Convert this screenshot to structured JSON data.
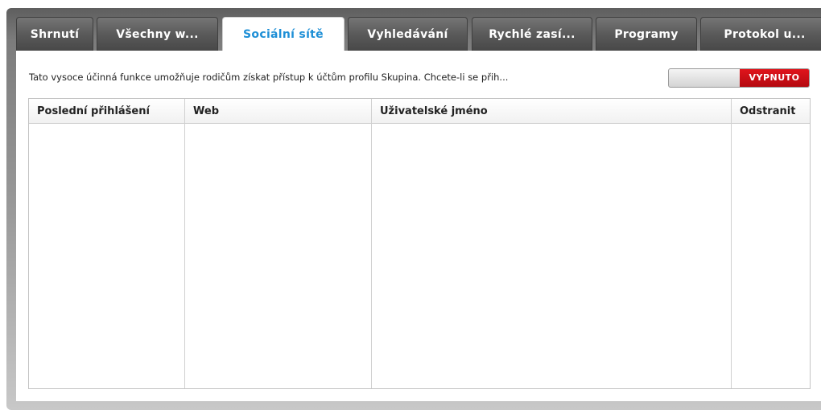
{
  "tabs": [
    {
      "label": "Shrnutí",
      "active": false
    },
    {
      "label": "Všechny w...",
      "active": false
    },
    {
      "label": "Sociální sítě",
      "active": true
    },
    {
      "label": "Vyhledávání",
      "active": false
    },
    {
      "label": "Rychlé zasí...",
      "active": false
    },
    {
      "label": "Programy",
      "active": false
    },
    {
      "label": "Protokol u...",
      "active": false
    }
  ],
  "panel": {
    "description": "Tato vysoce účinná funkce umožňuje rodičům získat přístup k účtům profilu Skupina. Chcete-li se přih...",
    "toggle": {
      "state_label": "VYPNUTO",
      "color": "#d61016"
    }
  },
  "table": {
    "columns": [
      "Poslední přihlášení",
      "Web",
      "Uživatelské jméno",
      "Odstranit"
    ],
    "rows": []
  },
  "colors": {
    "active_tab_text": "#1e8fd6",
    "tab_background": "#5a5a5a"
  }
}
